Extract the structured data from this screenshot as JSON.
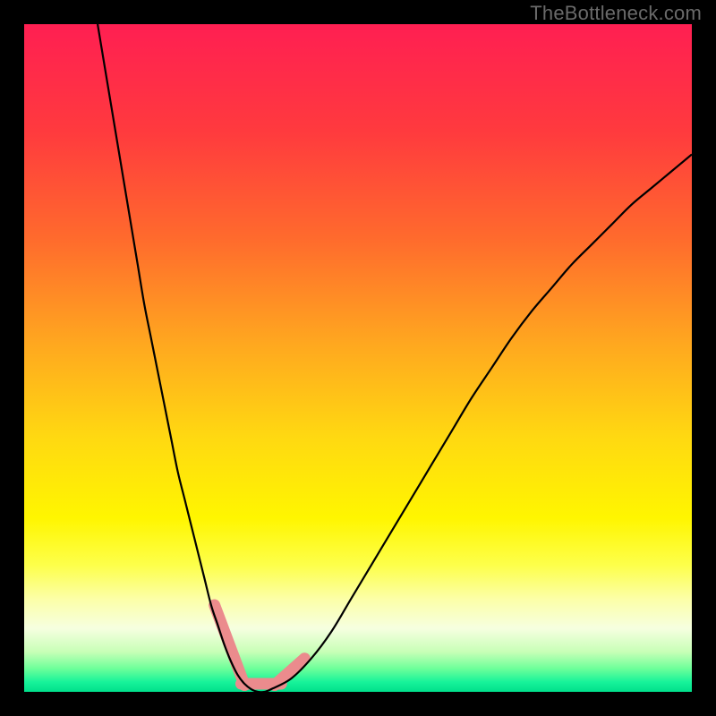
{
  "watermark": "TheBottleneck.com",
  "chart_data": {
    "type": "line",
    "title": "",
    "xlabel": "",
    "ylabel": "",
    "xlim": [
      0,
      100
    ],
    "ylim": [
      0,
      100
    ],
    "gradient_stops": [
      {
        "pct": 0.0,
        "color": "#ff1f52"
      },
      {
        "pct": 0.16,
        "color": "#ff3a3e"
      },
      {
        "pct": 0.32,
        "color": "#ff6a2d"
      },
      {
        "pct": 0.48,
        "color": "#ffa81f"
      },
      {
        "pct": 0.62,
        "color": "#ffd911"
      },
      {
        "pct": 0.74,
        "color": "#fff600"
      },
      {
        "pct": 0.81,
        "color": "#fdff4a"
      },
      {
        "pct": 0.86,
        "color": "#fcffa6"
      },
      {
        "pct": 0.905,
        "color": "#f6ffe0"
      },
      {
        "pct": 0.94,
        "color": "#c8ffb7"
      },
      {
        "pct": 0.965,
        "color": "#6eff9a"
      },
      {
        "pct": 0.985,
        "color": "#18f39a"
      },
      {
        "pct": 1.0,
        "color": "#00e08b"
      }
    ],
    "series": [
      {
        "name": "curve",
        "color": "#000000",
        "x": [
          11,
          12,
          13,
          14,
          15,
          16,
          17,
          18,
          19,
          20,
          21,
          22,
          23,
          24,
          25,
          26,
          27,
          28,
          29,
          30,
          31,
          32,
          33,
          34,
          35,
          36,
          37,
          40,
          43,
          46,
          49,
          52,
          55,
          58,
          61,
          64,
          67,
          70,
          73,
          76,
          79,
          82,
          85,
          88,
          91,
          94,
          97,
          100
        ],
        "y": [
          100,
          94,
          88,
          82,
          76,
          70,
          64,
          58,
          53,
          48,
          43,
          38,
          33,
          29,
          25,
          21,
          17,
          13,
          10,
          7,
          4.5,
          2.5,
          1.2,
          0.4,
          0,
          0,
          0.4,
          2,
          5,
          9,
          14,
          19,
          24,
          29,
          34,
          39,
          44,
          48.5,
          53,
          57,
          60.5,
          64,
          67,
          70,
          73,
          75.5,
          78,
          80.5
        ]
      }
    ],
    "highlight": {
      "color": "#eb8b8d",
      "segments": [
        {
          "x0": 28.5,
          "y0": 13,
          "x1": 33,
          "y1": 1
        },
        {
          "x0": 32.5,
          "y0": 1.2,
          "x1": 38.5,
          "y1": 1.2
        },
        {
          "x0": 37.5,
          "y0": 1,
          "x1": 42,
          "y1": 5
        }
      ]
    }
  }
}
